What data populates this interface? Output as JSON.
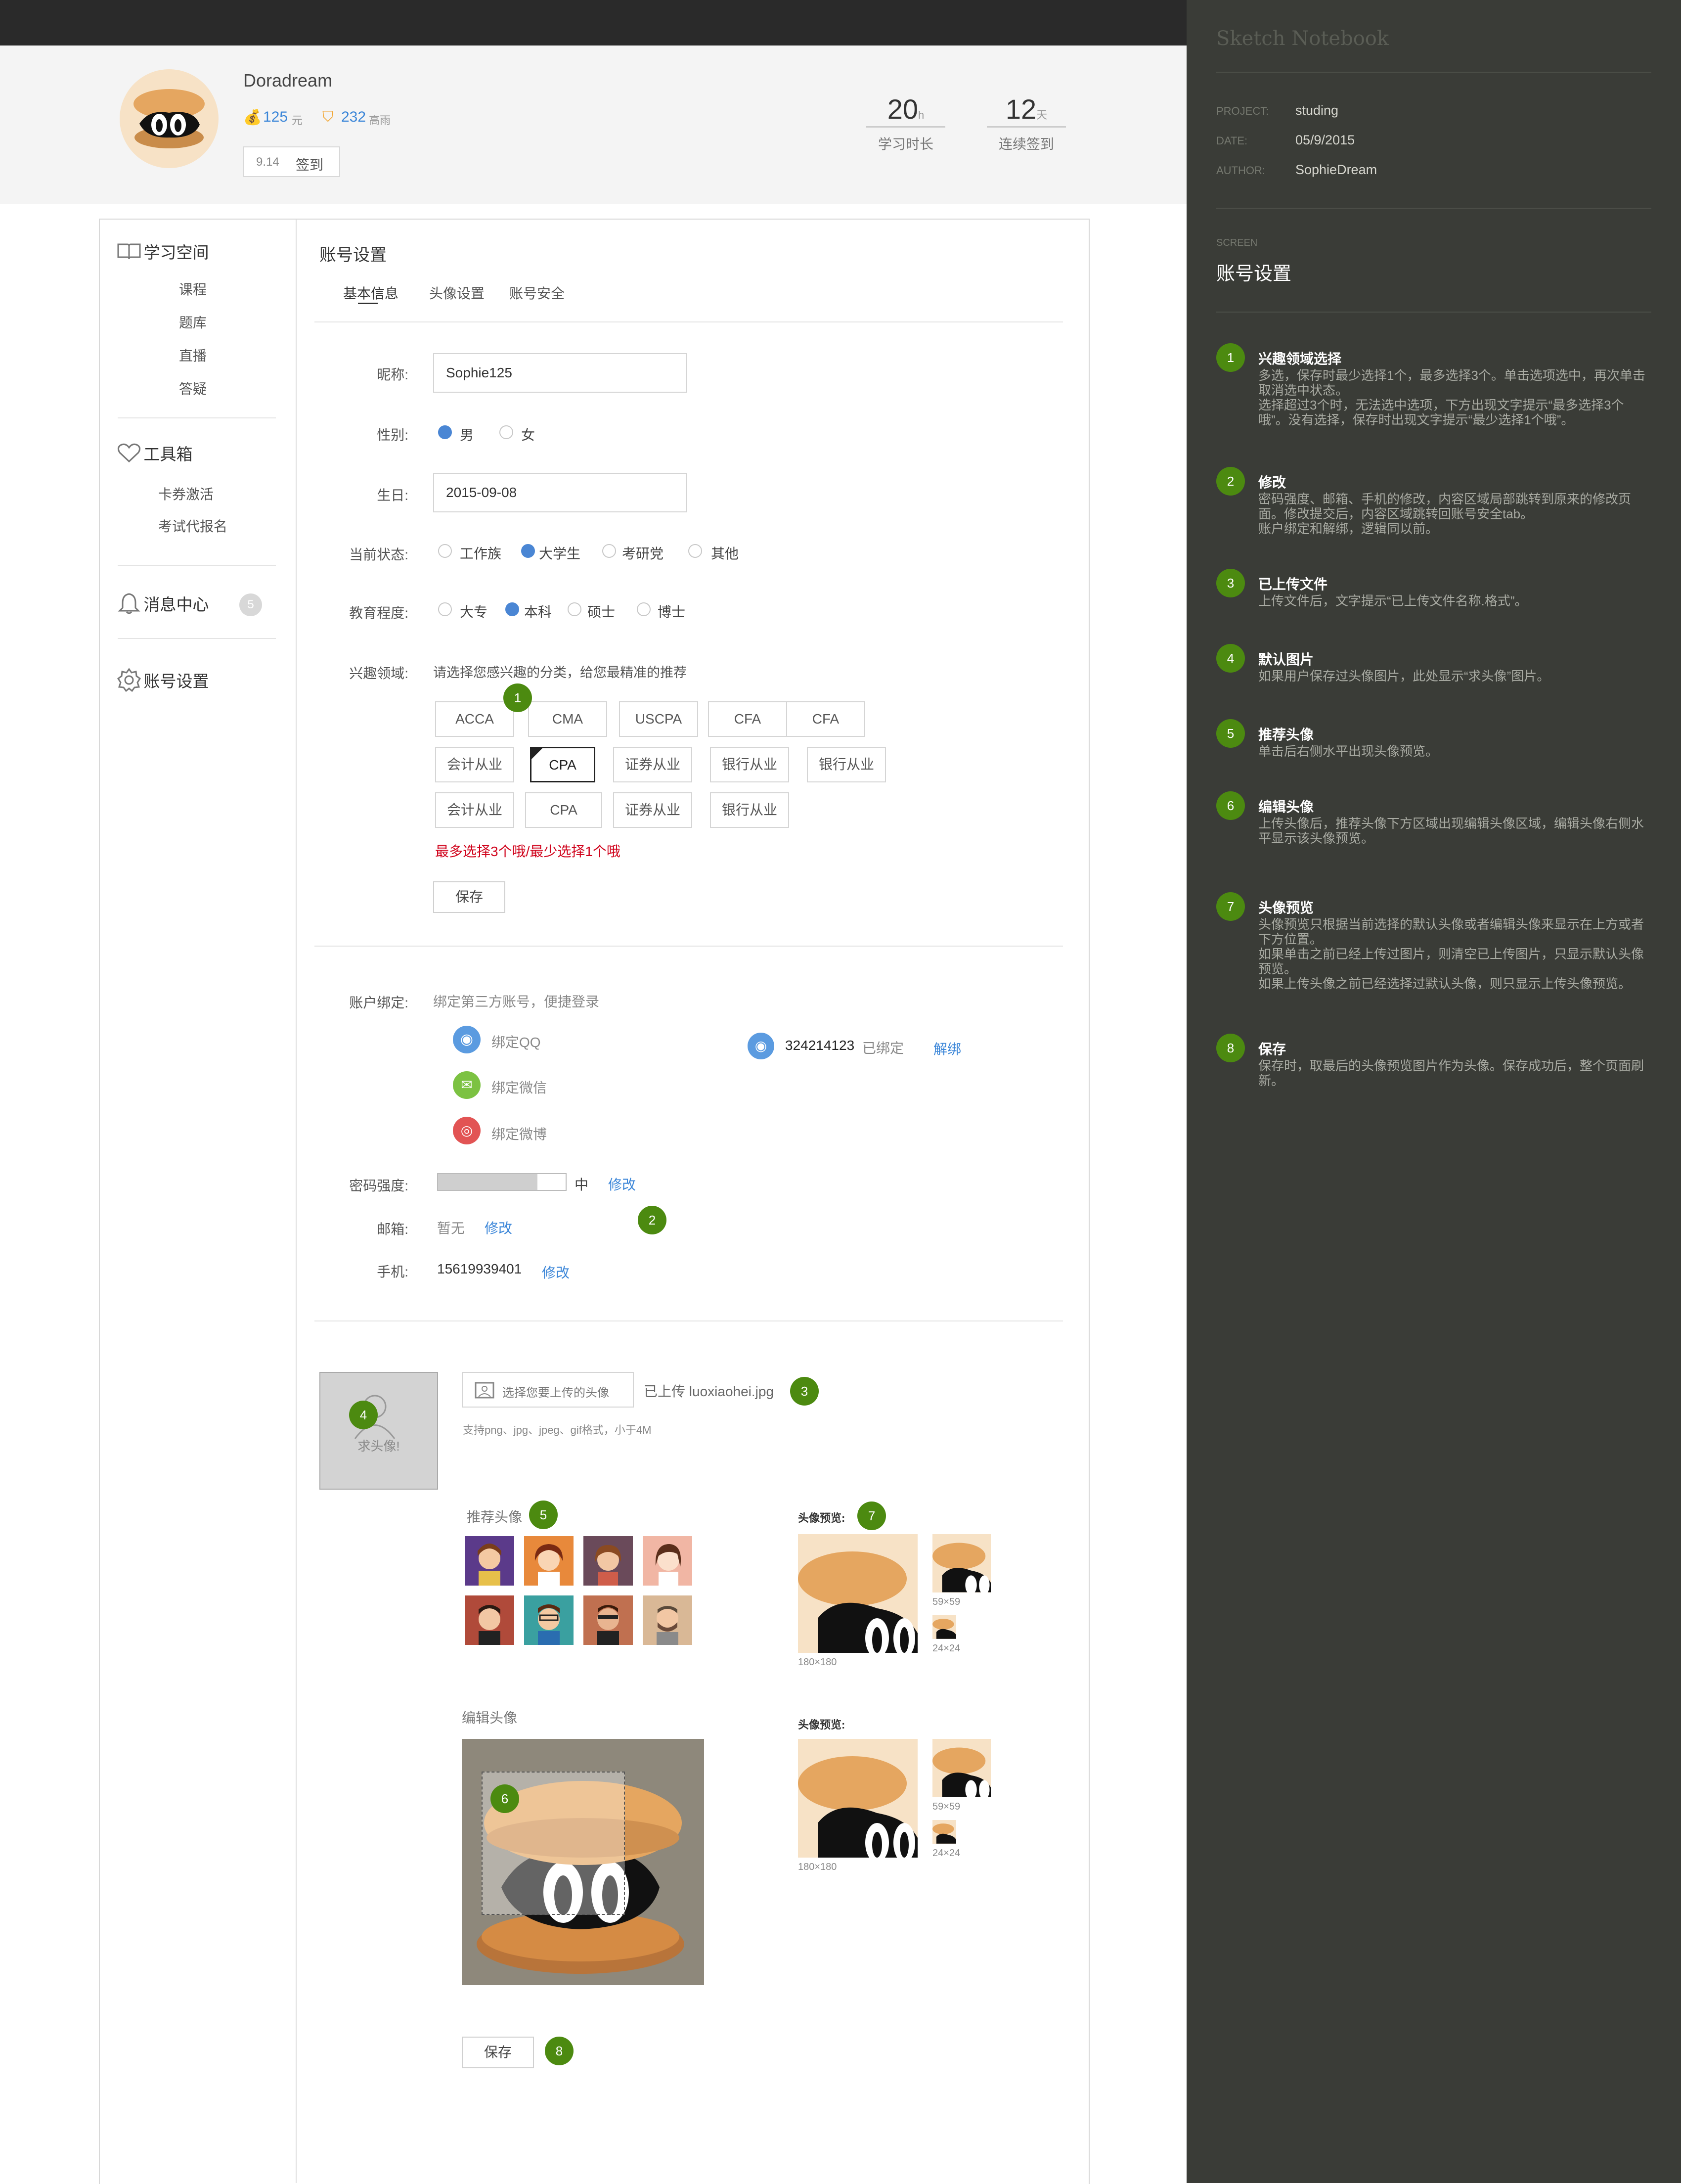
{
  "user": {
    "name": "Doradream",
    "coins": "125",
    "coins_unit": "元",
    "score": "232",
    "score_unit": "高雨",
    "signin_date": "9.14",
    "signin_label": "签到",
    "stats": [
      {
        "value": "20",
        "unit": "h",
        "label": "学习时长"
      },
      {
        "value": "12",
        "unit": "天",
        "label": "连续签到"
      }
    ]
  },
  "sidebar": {
    "sections": [
      {
        "title": "学习空间",
        "items": [
          "课程",
          "题库",
          "直播",
          "答疑"
        ]
      },
      {
        "title": "工具箱",
        "items": [
          "卡券激活",
          "考试代报名"
        ]
      },
      {
        "title": "消息中心",
        "badge": "5"
      },
      {
        "title": "账号设置"
      }
    ]
  },
  "main": {
    "title": "账号设置",
    "tabs": [
      "基本信息",
      "头像设置",
      "账号安全"
    ],
    "form": {
      "nickname_label": "昵称:",
      "nickname_value": "Sophie125",
      "gender_label": "性别:",
      "gender_options": [
        "男",
        "女"
      ],
      "gender_selected": "男",
      "birthday_label": "生日:",
      "birthday_value": "2015-09-08",
      "status_label": "当前状态:",
      "status_options": [
        "工作族",
        "大学生",
        "考研党",
        "其他"
      ],
      "status_selected": "大学生",
      "education_label": "教育程度:",
      "education_options": [
        "大专",
        "本科",
        "硕士",
        "博士"
      ],
      "education_selected": "本科",
      "interest_label": "兴趣领域:",
      "interest_hint": "请选择您感兴趣的分类，给您最精准的推荐",
      "interest_rows": [
        [
          "ACCA",
          "CMA",
          "USCPA",
          "CFA",
          "CFA"
        ],
        [
          "会计从业",
          "CPA",
          "证券从业",
          "银行从业",
          "银行从业"
        ],
        [
          "会计从业",
          "CPA",
          "证券从业",
          "银行从业"
        ]
      ],
      "interest_selected": "CPA",
      "interest_error": "最多选择3个哦/最少选择1个哦",
      "save_label": "保存"
    },
    "account": {
      "bind_label": "账户绑定:",
      "bind_hint": "绑定第三方账号，便捷登录",
      "bind_qq": "绑定QQ",
      "bind_wechat": "绑定微信",
      "bind_weibo": "绑定微博",
      "bound_qq_number": "324214123",
      "bound_status": "已绑定",
      "unbind_label": "解绑",
      "password_label": "密码强度:",
      "password_strength": "中",
      "password_level": 0.78,
      "modify_label": "修改",
      "email_label": "邮箱:",
      "email_value": "暂无",
      "phone_label": "手机:",
      "phone_value": "15619939401"
    },
    "avatar": {
      "default_text": "求头像!",
      "choose_label": "选择您要上传的头像",
      "uploaded_text": "已上传 luoxiaohei.jpg",
      "formats_hint": "支持png、jpg、jpeg、gif格式，小于4M",
      "recommend_label": "推荐头像",
      "preview_label": "头像预览:",
      "edit_label": "编辑头像",
      "size_large": "180×180",
      "size_medium": "59×59",
      "size_small": "24×24",
      "save_label": "保存"
    }
  },
  "notes": {
    "app_title": "Sketch Notebook",
    "meta": [
      {
        "key": "PROJECT:",
        "value": "studing"
      },
      {
        "key": "DATE:",
        "value": "05/9/2015"
      },
      {
        "key": "AUTHOR:",
        "value": "SophieDream"
      }
    ],
    "screen_key": "SCREEN",
    "screen_value": "账号设置",
    "items": [
      {
        "num": "1",
        "title": "兴趣领域选择",
        "body": "多选，保存时最少选择1个，最多选择3个。单击选项选中，再次单击取消选中状态。\n选择超过3个时，无法选中选项，下方出现文字提示“最多选择3个哦”。没有选择，保存时出现文字提示“最少选择1个哦”。"
      },
      {
        "num": "2",
        "title": "修改",
        "body": "密码强度、邮箱、手机的修改，内容区域局部跳转到原来的修改页面。修改提交后，内容区域跳转回账号安全tab。\n账户绑定和解绑，逻辑同以前。"
      },
      {
        "num": "3",
        "title": "已上传文件",
        "body": "上传文件后，文字提示“已上传文件名称.格式”。"
      },
      {
        "num": "4",
        "title": "默认图片",
        "body": "如果用户保存过头像图片，此处显示“求头像”图片。"
      },
      {
        "num": "5",
        "title": "推荐头像",
        "body": "单击后右侧水平出现头像预览。"
      },
      {
        "num": "6",
        "title": "编辑头像",
        "body": "上传头像后，推荐头像下方区域出现编辑头像区域，编辑头像右侧水平显示该头像预览。"
      },
      {
        "num": "7",
        "title": "头像预览",
        "body": "头像预览只根据当前选择的默认头像或者编辑头像来显示在上方或者下方位置。\n如果单击之前已经上传过图片，则清空已上传图片，只显示默认头像预览。\n如果上传头像之前已经选择过默认头像，则只显示上传头像预览。"
      },
      {
        "num": "8",
        "title": "保存",
        "body": "保存时，取最后的头像预览图片作为头像。保存成功后，整个页面刷新。"
      }
    ]
  },
  "badges": [
    "1",
    "2",
    "3",
    "4",
    "5",
    "6",
    "7",
    "8"
  ],
  "colors": {
    "accent": "#3b86d8",
    "badge": "#4c8a10",
    "error": "#d0021b",
    "notes_bg": "#3a3c37"
  }
}
